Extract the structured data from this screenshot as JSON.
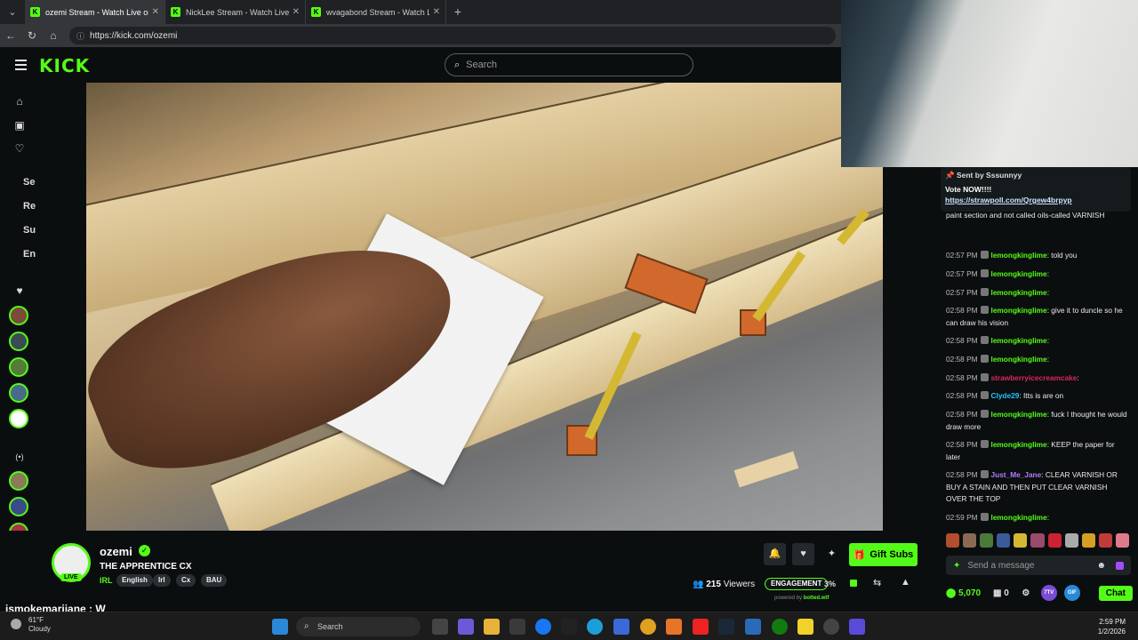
{
  "browser": {
    "tabs": [
      {
        "title": "ozemi Stream - Watch Live on Kick",
        "active": true
      },
      {
        "title": "NickLee Stream - Watch Live on Kick",
        "active": false
      },
      {
        "title": "wvagabond Stream - Watch Live on Kick",
        "active": false
      }
    ],
    "url": "https://kick.com/ozemi"
  },
  "kick": {
    "logo": "KICK",
    "search_placeholder": "Search"
  },
  "sidebar": {
    "sections": [
      "Se",
      "Re",
      "Su",
      "En"
    ]
  },
  "stream": {
    "channel": "ozemi",
    "title": "THE APPRENTICE CX",
    "category": "IRL",
    "tags": [
      "English",
      "Irl",
      "Cx",
      "BAU"
    ],
    "live_badge": "LIVE",
    "viewers": "215",
    "viewers_label": "Viewers",
    "engagement_label": "ENGAGEMENT",
    "engagement_pct": "3%",
    "powered_by": "powered by",
    "powered_by_brand": "botted.wtf",
    "gift_label": "Gift Subs",
    "caption": "ismokemarijane : W"
  },
  "chat": {
    "pinned": {
      "sent_by": "Sent by",
      "sent_user": "Sssunnyy",
      "text": "Vote NOW!!!!",
      "link": "https://strawpoll.com/Qrgew4brpyp"
    },
    "messages": [
      {
        "time": "",
        "user": "",
        "color": "#ffffff",
        "text": "paint section and not called oils-called VARNISH"
      },
      {
        "time": "02:57 PM",
        "user": "lemongkinglime",
        "color": "#53fc18",
        "text": ": told you"
      },
      {
        "time": "02:57 PM",
        "user": "lemongkinglime",
        "color": "#53fc18",
        "text": ":"
      },
      {
        "time": "02:57 PM",
        "user": "lemongkinglime",
        "color": "#53fc18",
        "text": ":"
      },
      {
        "time": "02:58 PM",
        "user": "lemongkinglime",
        "color": "#53fc18",
        "text": ": give it to duncle so he can draw his vision"
      },
      {
        "time": "02:58 PM",
        "user": "lemongkinglime",
        "color": "#53fc18",
        "text": ":"
      },
      {
        "time": "02:58 PM",
        "user": "lemongkinglime",
        "color": "#53fc18",
        "text": ":"
      },
      {
        "time": "02:58 PM",
        "user": "strawberryicecreamcake",
        "color": "#e0245e",
        "text": ":"
      },
      {
        "time": "02:58 PM",
        "user": "Clyde29",
        "color": "#1ec8ff",
        "text": ": Itts is are on"
      },
      {
        "time": "02:58 PM",
        "user": "lemongkinglime",
        "color": "#53fc18",
        "text": ": fuck I thought he would draw more"
      },
      {
        "time": "02:58 PM",
        "user": "lemongkinglime",
        "color": "#53fc18",
        "text": ": KEEP the paper for later"
      },
      {
        "time": "02:58 PM",
        "user": "Just_Me_Jane",
        "color": "#b27bff",
        "text": ": CLEAR VARNISH OR BUY A STAIN AND THEN PUT CLEAR VARNISH OVER THE TOP"
      },
      {
        "time": "02:59 PM",
        "user": "lemongkinglime",
        "color": "#53fc18",
        "text": ":"
      }
    ],
    "input_placeholder": "Send a message",
    "points": "5,070",
    "count": "0",
    "chat_button": "Chat",
    "badge_7tv": "7TV",
    "badge_gif": "GIF"
  },
  "taskbar": {
    "temp": "61°F",
    "condition": "Cloudy",
    "search": "Search",
    "time": "2:59 PM",
    "date": "1/2/2026"
  }
}
